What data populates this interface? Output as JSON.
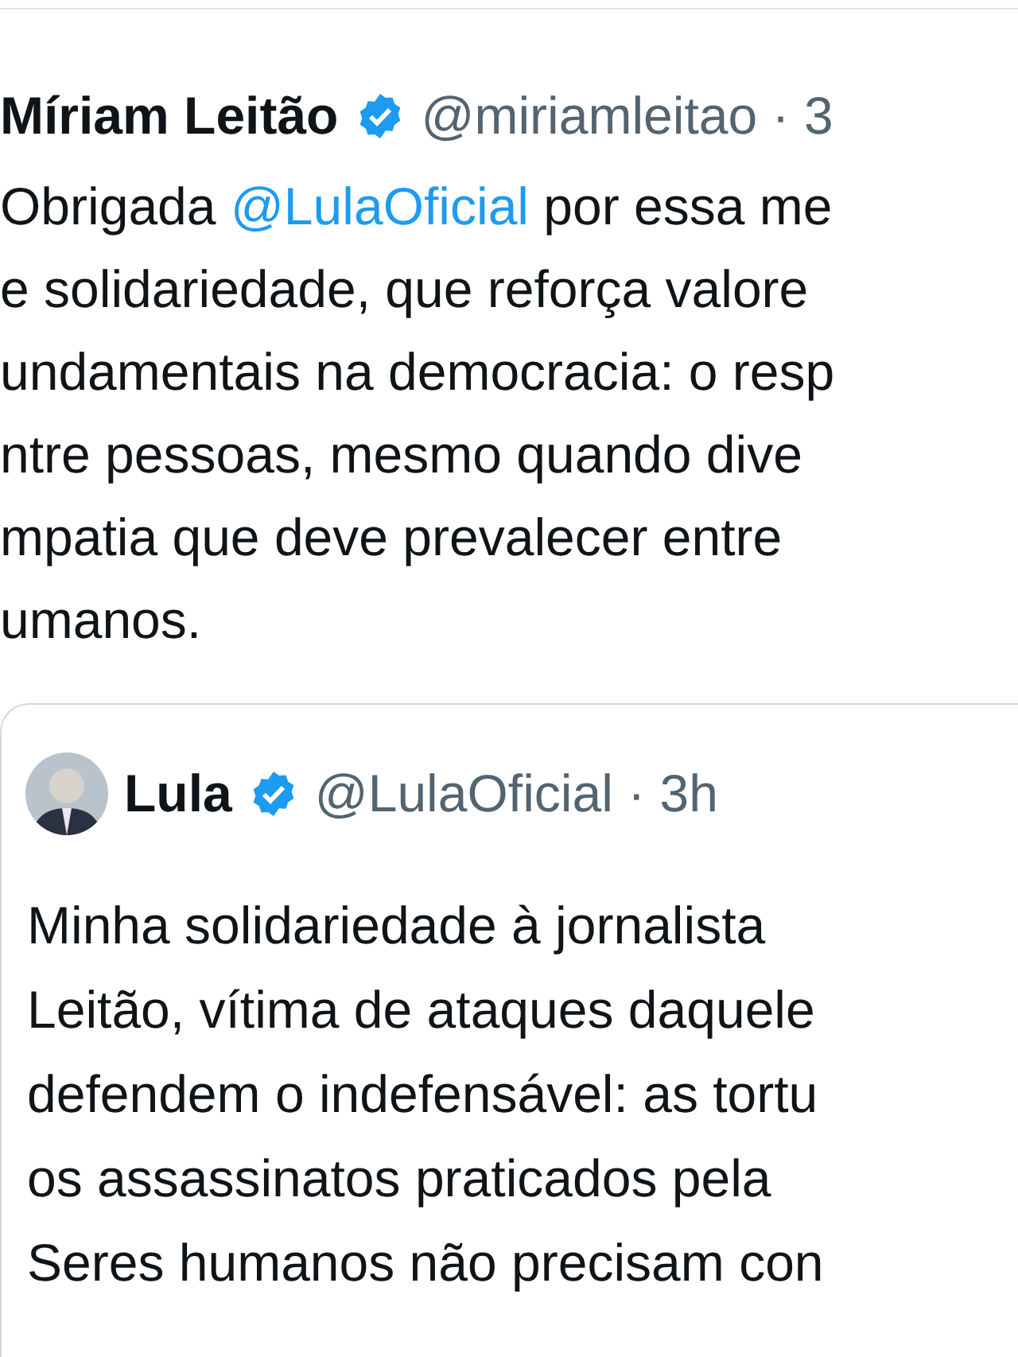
{
  "tweet": {
    "name": "Míriam Leitão",
    "verified": true,
    "handle": "@miriamleitao",
    "separator": "·",
    "time": "3",
    "lines": [
      {
        "parts": [
          {
            "kind": "text",
            "text": "Obrigada "
          },
          {
            "kind": "mention",
            "text": "@LulaOficial"
          },
          {
            "kind": "text",
            "text": " por essa me"
          }
        ]
      },
      {
        "parts": [
          {
            "kind": "text",
            "text": "e solidariedade, que reforça valore"
          }
        ]
      },
      {
        "parts": [
          {
            "kind": "text",
            "text": "undamentais na democracia: o resp"
          }
        ]
      },
      {
        "parts": [
          {
            "kind": "text",
            "text": "ntre pessoas, mesmo quando dive"
          }
        ]
      },
      {
        "parts": [
          {
            "kind": "text",
            "text": "mpatia que deve prevalecer entre"
          }
        ]
      },
      {
        "parts": [
          {
            "kind": "text",
            "text": "umanos."
          }
        ]
      }
    ]
  },
  "quoted_tweet": {
    "name": "Lula",
    "verified": true,
    "handle": "@LulaOficial",
    "separator": "·",
    "time": "3h",
    "lines": [
      "Minha solidariedade à jornalista",
      "Leitão, vítima de ataques daquele",
      "defendem o indefensável: as tortu",
      "os assassinatos praticados pela",
      "Seres humanos não precisam con"
    ]
  }
}
